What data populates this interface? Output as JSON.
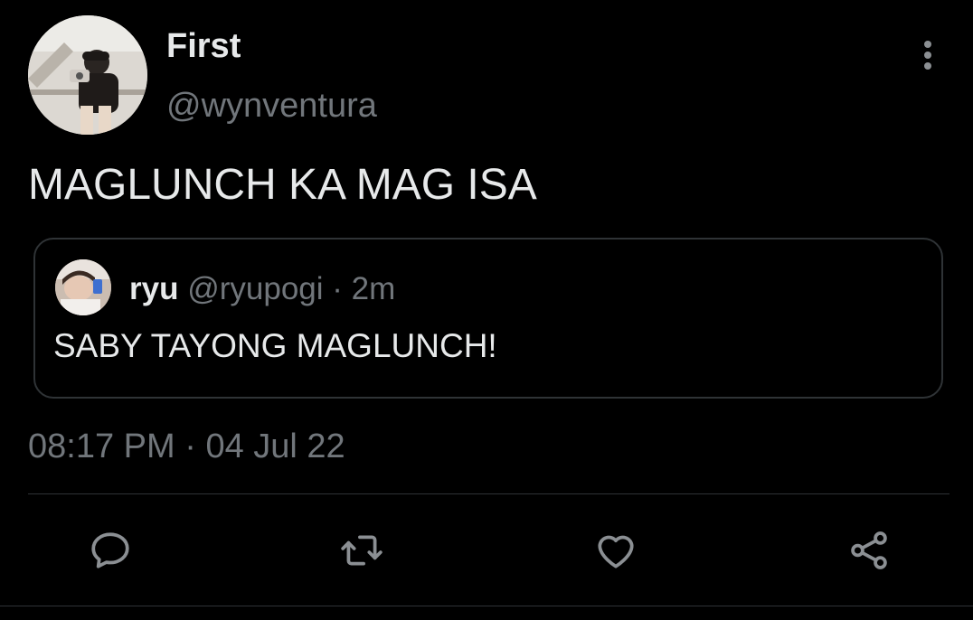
{
  "author": {
    "display_name": "First",
    "handle": "@wynventura"
  },
  "tweet": {
    "text": "MAGLUNCH KA MAG ISA",
    "timestamp": "08:17 PM",
    "separator": "·",
    "date": "04 Jul 22"
  },
  "quoted": {
    "display_name": "ryu",
    "handle": "@ryupogi",
    "separator": "·",
    "time": "2m",
    "text": "SABY TAYONG MAGLUNCH!"
  },
  "actions": {
    "icons": [
      "reply-icon",
      "retweet-icon",
      "like-icon",
      "share-icon"
    ]
  },
  "colors": {
    "background": "#000000",
    "text_primary": "#e7e9ea",
    "text_secondary": "#71767b",
    "border": "#2f3336"
  }
}
